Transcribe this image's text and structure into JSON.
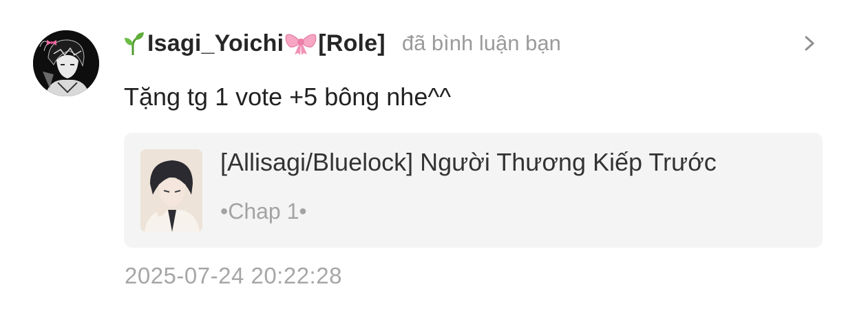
{
  "notification": {
    "user": {
      "name": "Isagi_Yoichi",
      "role": "[Role]",
      "prefix_icon": "sprout-icon",
      "suffix_icon": "ribbon-bow-icon"
    },
    "action_text": "đã bình luận bạn",
    "comment": "Tặng tg 1 vote +5 bông nhe^^",
    "story": {
      "title": "[Allisagi/Bluelock] Người Thương Kiếp Trước",
      "chapter": "•Chap 1•"
    },
    "timestamp": "2025-07-24 20:22:28"
  },
  "colors": {
    "background": "#ffffff",
    "name": "#262626",
    "muted": "#9a9a9a",
    "card_bg": "#f4f4f4",
    "bow_pink": "#f08fb2",
    "sprout_green": "#5fae3c"
  }
}
